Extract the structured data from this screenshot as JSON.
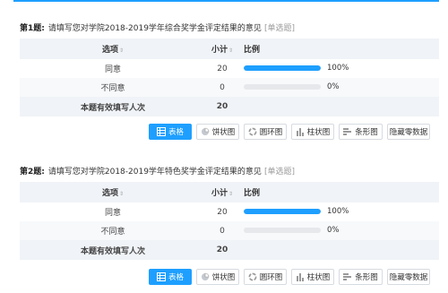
{
  "questions": [
    {
      "num": "第1题:",
      "text": "请填写您对学院2018-2019学年综合奖学金评定结果的意见",
      "type": "[单选题]",
      "headers": {
        "option": "选项",
        "count": "小计",
        "ratio": "比例"
      },
      "rows": [
        {
          "option": "同意",
          "count": "20",
          "percent": "100%",
          "fraction": 1.0
        },
        {
          "option": "不同意",
          "count": "0",
          "percent": "0%",
          "fraction": 0.0
        }
      ],
      "total_label": "本题有效填写人次",
      "total": "20"
    },
    {
      "num": "第2题:",
      "text": "请填写您对学院2018-2019学年特色奖学金评定结果的意见",
      "type": "[单选题]",
      "headers": {
        "option": "选项",
        "count": "小计",
        "ratio": "比例"
      },
      "rows": [
        {
          "option": "同意",
          "count": "20",
          "percent": "100%",
          "fraction": 1.0
        },
        {
          "option": "不同意",
          "count": "0",
          "percent": "0%",
          "fraction": 0.0
        }
      ],
      "total_label": "本题有效填写人次",
      "total": "20"
    }
  ],
  "toolbar": {
    "table": "表格",
    "pie": "饼状图",
    "ring": "圆环图",
    "column": "柱状图",
    "bar": "条形图",
    "hide_zero": "隐藏零数据"
  },
  "colors": {
    "accent": "#1e9fff",
    "track": "#e6e8eb"
  },
  "icons": [
    "table-icon",
    "pie-chart-icon",
    "ring-chart-icon",
    "column-chart-icon",
    "bar-chart-icon"
  ]
}
